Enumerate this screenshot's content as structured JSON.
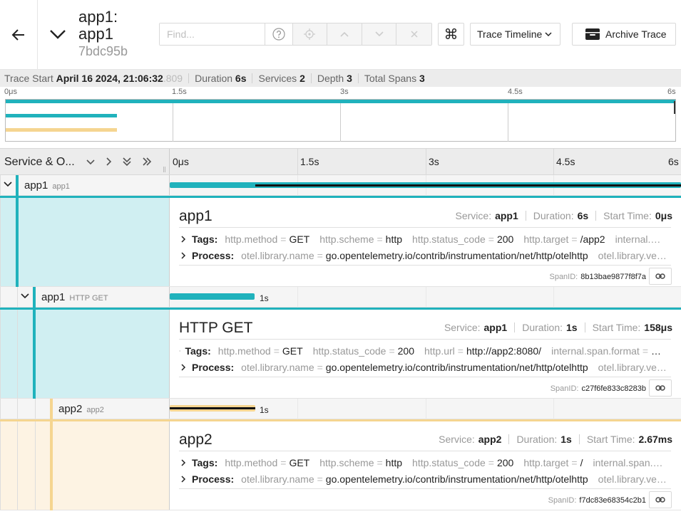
{
  "header": {
    "title": "app1: app1",
    "trace_id": "7bdc95b",
    "find_placeholder": "Find...",
    "view_label": "Trace Timeline",
    "archive_label": "Archive Trace",
    "keyboard_glyph": "⌘"
  },
  "summary": {
    "start_label": "Trace Start",
    "start_value": "April 16 2024, 21:06:32",
    "start_ms": ".809",
    "duration_label": "Duration",
    "duration_value": "6s",
    "services_label": "Services",
    "services_value": "2",
    "depth_label": "Depth",
    "depth_value": "3",
    "spans_label": "Total Spans",
    "spans_value": "3"
  },
  "minimap": {
    "ticks": [
      "0μs",
      "1.5s",
      "3s",
      "4.5s",
      "6s"
    ]
  },
  "table": {
    "column_title": "Service & O...",
    "ticks": [
      "0μs",
      "1.5s",
      "3s",
      "4.5s",
      "6s"
    ]
  },
  "colors": {
    "app1": "#20b2bc",
    "app2": "#f5d590",
    "app1_bg": "#d0eff2",
    "app2_bg": "#fdf3e3"
  },
  "spans": [
    {
      "service": "app1",
      "operation": "app1",
      "title": "app1",
      "service_label": "Service:",
      "service_value": "app1",
      "duration_label": "Duration:",
      "duration_value": "6s",
      "start_label": "Start Time:",
      "start_value": "0μs",
      "tags_label": "Tags:",
      "tags": [
        {
          "k": "http.method",
          "v": "GET"
        },
        {
          "k": "http.scheme",
          "v": "http"
        },
        {
          "k": "http.status_code",
          "v": "200"
        },
        {
          "k": "http.target",
          "v": "/app2"
        },
        {
          "k": "internal.…",
          "v": ""
        }
      ],
      "process_label": "Process:",
      "process": [
        {
          "k": "otel.library.name",
          "v": "go.opentelemetry.io/contrib/instrumentation/net/http/otelhttp"
        },
        {
          "k": "otel.library.ve…",
          "v": ""
        }
      ],
      "spanid_label": "SpanID:",
      "spanid": "8b13bae9877f8f7a"
    },
    {
      "service": "app1",
      "operation": "HTTP GET",
      "title": "HTTP GET",
      "bar_label": "1s",
      "service_label": "Service:",
      "service_value": "app1",
      "duration_label": "Duration:",
      "duration_value": "1s",
      "start_label": "Start Time:",
      "start_value": "158μs",
      "tags_label": "Tags:",
      "tags": [
        {
          "k": "http.method",
          "v": "GET"
        },
        {
          "k": "http.status_code",
          "v": "200"
        },
        {
          "k": "http.url",
          "v": "http://app2:8080/"
        },
        {
          "k": "internal.span.format",
          "v": "…"
        }
      ],
      "process_label": "Process:",
      "process": [
        {
          "k": "otel.library.name",
          "v": "go.opentelemetry.io/contrib/instrumentation/net/http/otelhttp"
        },
        {
          "k": "otel.library.ve…",
          "v": ""
        }
      ],
      "spanid_label": "SpanID:",
      "spanid": "c27f6fe833c8283b"
    },
    {
      "service": "app2",
      "operation": "app2",
      "title": "app2",
      "bar_label": "1s",
      "service_label": "Service:",
      "service_value": "app2",
      "duration_label": "Duration:",
      "duration_value": "1s",
      "start_label": "Start Time:",
      "start_value": "2.67ms",
      "tags_label": "Tags:",
      "tags": [
        {
          "k": "http.method",
          "v": "GET"
        },
        {
          "k": "http.scheme",
          "v": "http"
        },
        {
          "k": "http.status_code",
          "v": "200"
        },
        {
          "k": "http.target",
          "v": "/"
        },
        {
          "k": "internal.span.…",
          "v": ""
        }
      ],
      "process_label": "Process:",
      "process": [
        {
          "k": "otel.library.name",
          "v": "go.opentelemetry.io/contrib/instrumentation/net/http/otelhttp"
        },
        {
          "k": "otel.library.ve…",
          "v": ""
        }
      ],
      "spanid_label": "SpanID:",
      "spanid": "f7dc83e68354c2b1"
    }
  ]
}
